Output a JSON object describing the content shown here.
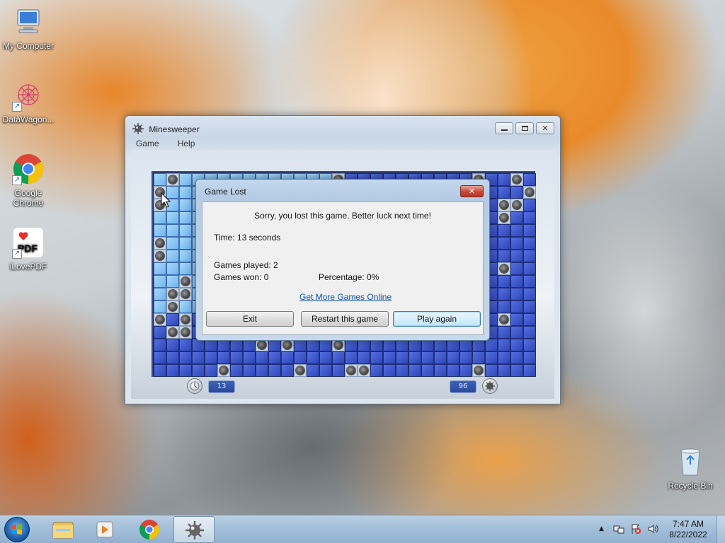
{
  "desktop": {
    "icons": [
      {
        "label": "My Computer",
        "icon": "computer-icon"
      },
      {
        "label": "DataWagon...",
        "icon": "datawagon-icon"
      },
      {
        "label": "Google Chrome",
        "icon": "chrome-icon"
      },
      {
        "label": "iLovePDF",
        "icon": "ilovepdf-icon"
      },
      {
        "label": "Recycle Bin",
        "icon": "recycle-bin-icon"
      }
    ]
  },
  "window": {
    "title": "Minesweeper",
    "menu": [
      "Game",
      "Help"
    ],
    "timer_value": "13",
    "mines_value": "96",
    "board": {
      "rows": 16,
      "cols": 30
    }
  },
  "dialog": {
    "title": "Game Lost",
    "close_label": "✕",
    "message": "Sorry, you lost this game. Better luck next time!",
    "time": "Time: 13 seconds",
    "games_played": "Games played: 2",
    "games_won": "Games won: 0",
    "percentage": "Percentage: 0%",
    "link": "Get More Games Online",
    "buttons": {
      "exit": "Exit",
      "restart": "Restart this game",
      "play_again": "Play again"
    }
  },
  "taskbar": {
    "apps": [
      "windows-explorer-icon",
      "media-player-icon",
      "chrome-icon",
      "minesweeper-icon"
    ],
    "time": "7:47 AM",
    "date": "8/22/2022"
  },
  "colors": {
    "accent": "#2e46b8",
    "link": "#0a52b8",
    "close": "#c8463a"
  }
}
